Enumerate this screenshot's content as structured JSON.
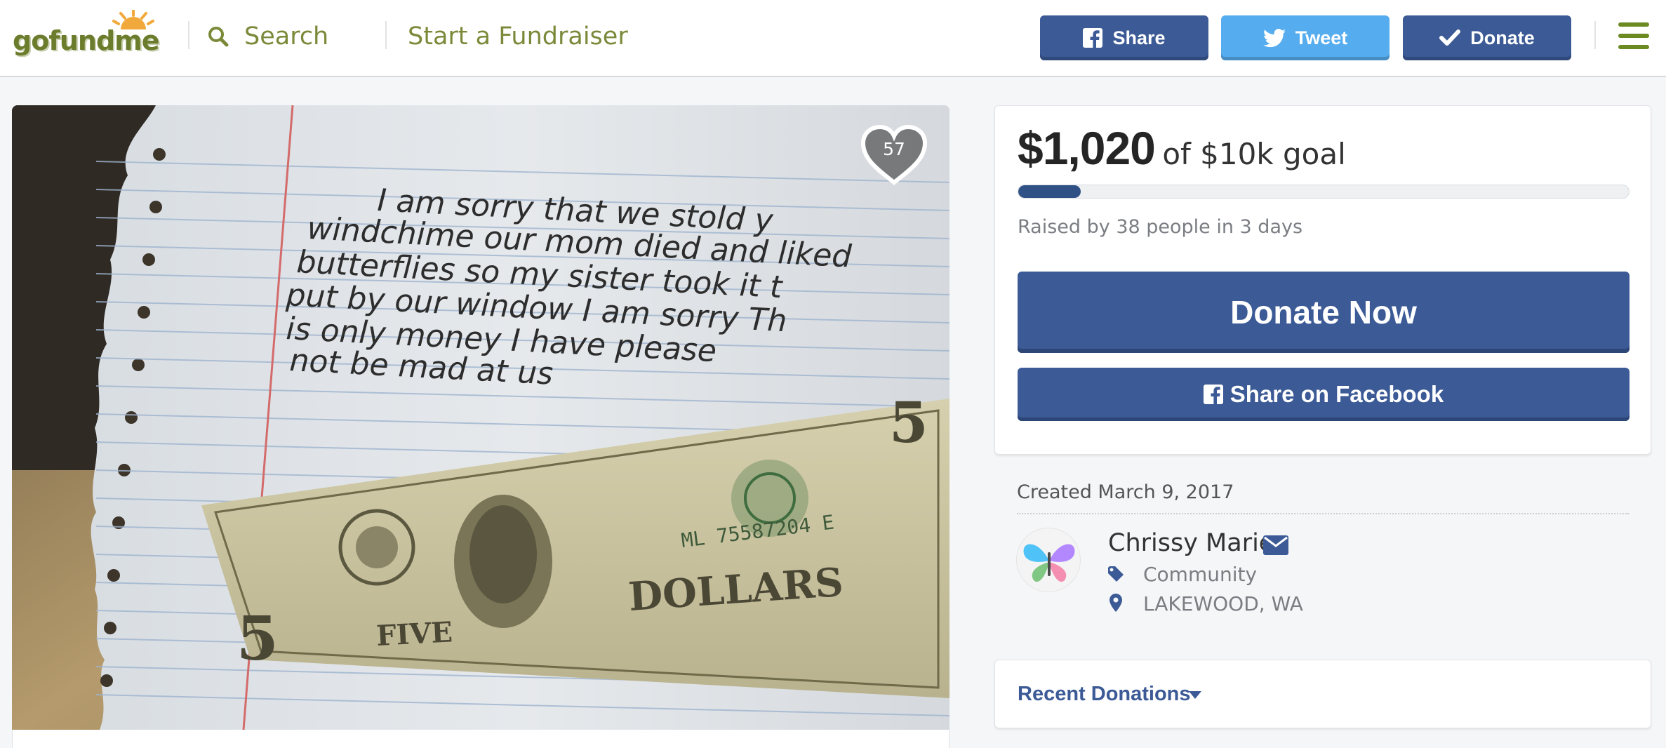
{
  "header": {
    "logo_text": "gofundme",
    "search_label": "Search",
    "start_fundraiser": "Start a Fundraiser",
    "share_label": "Share",
    "tweet_label": "Tweet",
    "donate_label": "Donate"
  },
  "photo": {
    "heart_count": "57",
    "note_lines": [
      "I am sorry that we stold y",
      "windchime our mom died and liked",
      "butterflies so my sister took it t",
      "put by our window I am sorry Th",
      "is only money I have please",
      "not be mad at us"
    ],
    "bill_serial": "ML 75587204 E",
    "bill_dollars": "DOLLARS",
    "bill_five": "FIVE"
  },
  "donation": {
    "amount": "$1,020",
    "goal": "of $10k goal",
    "progress_fraction": 0.102,
    "raised_by": "Raised by 38 people in 3 days",
    "donate_now": "Donate Now",
    "share_facebook": "Share on Facebook"
  },
  "organizer": {
    "created": "Created March 9, 2017",
    "name": "Chrissy Marie",
    "category": "Community",
    "location": "LAKEWOOD, WA"
  },
  "recent_donations": {
    "label": "Recent Donations"
  },
  "colors": {
    "brand_green": "#6b8a22",
    "facebook_blue": "#3b5a96",
    "twitter_blue": "#55acee",
    "progress_fill": "#2f5186"
  },
  "icons": [
    "search-icon",
    "facebook-icon",
    "twitter-icon",
    "checkmark-icon",
    "hamburger-menu-icon",
    "heart-icon",
    "mail-icon",
    "tag-icon",
    "map-pin-icon",
    "caret-down-icon"
  ]
}
